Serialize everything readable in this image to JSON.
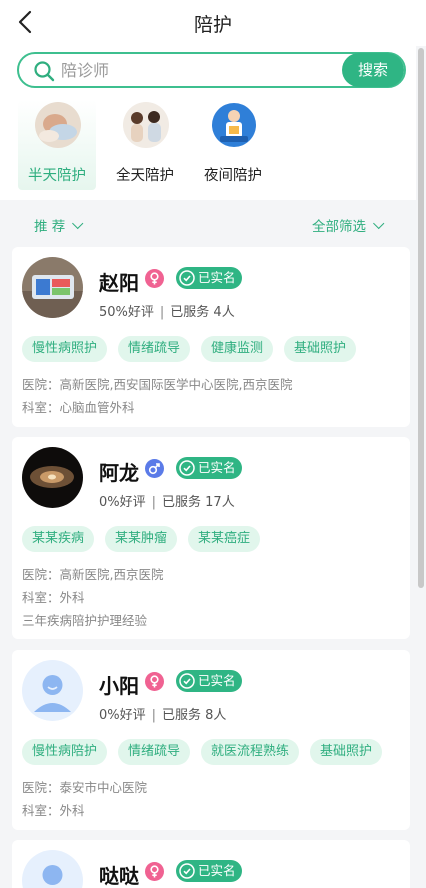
{
  "header": {
    "title": "陪护",
    "back_icon": "back-icon"
  },
  "search": {
    "placeholder": "陪诊师",
    "value": "",
    "button_label": "搜索",
    "accent": "#2fb584"
  },
  "categories": [
    {
      "label": "半天陪护",
      "active": true
    },
    {
      "label": "全天陪护",
      "active": false
    },
    {
      "label": "夜间陪护",
      "active": false
    }
  ],
  "filters": {
    "recommend_label": "推 荐",
    "all_filter_label": "全部筛选"
  },
  "caregivers": [
    {
      "name": "赵阳",
      "gender": "female",
      "verified_label": "已实名",
      "rating": "50%好评",
      "served": "已服务 4人",
      "tags": [
        "慢性病照护",
        "情绪疏导",
        "健康监测",
        "基础照护"
      ],
      "lines": [
        "医院：高新医院,西安国际医学中心医院,西京医院",
        "科室：心脑血管外科"
      ]
    },
    {
      "name": "阿龙",
      "gender": "male",
      "verified_label": "已实名",
      "rating": "0%好评",
      "served": "已服务 17人",
      "tags": [
        "某某疾病",
        "某某肿瘤",
        "某某癌症"
      ],
      "lines": [
        "医院：高新医院,西京医院",
        "科室：外科",
        "三年疾病陪护护理经验"
      ]
    },
    {
      "name": "小阳",
      "gender": "female",
      "verified_label": "已实名",
      "rating": "0%好评",
      "served": "已服务 8人",
      "tags": [
        "慢性病陪护",
        "情绪疏导",
        "就医流程熟练",
        "基础照护"
      ],
      "lines": [
        "医院：泰安市中心医院",
        "科室：外科"
      ]
    },
    {
      "name": "哒哒",
      "gender": "female",
      "verified_label": "已实名"
    }
  ],
  "colors": {
    "accent": "#2fb584",
    "female": "#f06292",
    "male": "#5b7be8",
    "tag_bg": "#e1f6ec"
  }
}
